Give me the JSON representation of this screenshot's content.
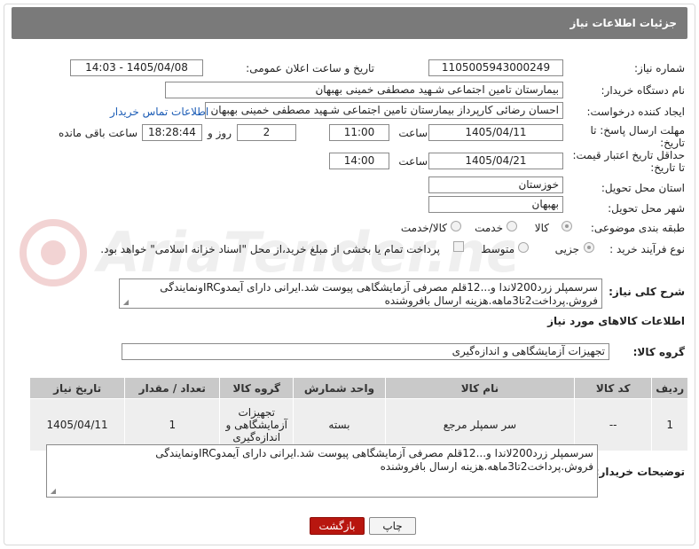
{
  "header": {
    "title": "جزئیات اطلاعات نیاز"
  },
  "fields": {
    "need_number": {
      "label": "شماره نیاز:",
      "value": "1105005943000249"
    },
    "announce": {
      "label": "تاریخ و ساعت اعلان عمومی:",
      "value": "1405/04/08 - 14:03"
    },
    "buyer_org": {
      "label": "نام دستگاه خریدار:",
      "value": "بیمارستان تامین اجتماعی شـهید مصطفی خمینی بهبهان"
    },
    "creator": {
      "label": "ایجاد کننده درخواست:",
      "value": "احسان رضائی کارپرداز بیمارستان تامین اجتماعی شـهید مصطفی خمینی بهبهان",
      "contact_link": "اطلاعات تماس خریدار"
    },
    "reply_deadline": {
      "label_line1": "مهلت ارسال پاسخ: تا",
      "label_line2": "تاریخ:",
      "date": "1405/04/11",
      "time_label": "ساعت",
      "time": "11:00",
      "days": "2",
      "days_label": "روز و",
      "remaining": "18:28:44",
      "remaining_label": "ساعت باقی مانده"
    },
    "price_validity": {
      "label_line1": "حداقل تاریخ اعتبار قیمت:",
      "label_line2": "تا تاریخ:",
      "date": "1405/04/21",
      "time_label": "ساعت",
      "time": "14:00"
    },
    "province": {
      "label": "استان محل تحویل:",
      "value": "خوزستان"
    },
    "city": {
      "label": "شهر محل تحویل:",
      "value": "بهبهان"
    },
    "category": {
      "label": "طبقه بندی موضوعی:",
      "options": [
        "کالا",
        "خدمت",
        "کالا/خدمت"
      ],
      "selected": "کالا"
    },
    "process": {
      "label": "نوع فرآیند خرید :",
      "options": [
        "جزیی",
        "متوسط"
      ],
      "selected": "جزیی",
      "payment_note": "پرداخت تمام یا بخشی از مبلغ خرید،از محل \"اسناد خزانه اسلامی\" خواهد بود."
    }
  },
  "summary": {
    "label": "شرح کلی نیاز:",
    "text": "سرسمپلر زرد200لاندا و...12قلم مصرفی آزمایشگاهی پیوست شد.ایرانی دارای آیمدوIRCونمایندگی فروش.پرداخت2تا3ماهه.هزینه ارسال بافروشنده"
  },
  "goods": {
    "section_title": "اطلاعات کالاهای مورد نیاز",
    "group_label": "گروه کالا:",
    "group_value": "تجهیزات آزمایشگاهی و اندازه‌گیری",
    "columns": [
      "ردیف",
      "کد کالا",
      "نام کالا",
      "واحد شمارش",
      "گروه کالا",
      "تعداد / مقدار",
      "تاریخ نیاز"
    ],
    "rows": [
      {
        "row": "1",
        "code": "--",
        "name": "سر سمپلر مرجع",
        "unit": "بسته",
        "group": "تجهیزات آزمایشگاهی و اندازه‌گیری",
        "qty": "1",
        "date": "1405/04/11"
      }
    ]
  },
  "buyer_notes": {
    "label": "توضیحات خریدار:",
    "text": "سرسمپلر زرد200لاندا و...12قلم مصرفی آزمایشگاهی پیوست شد.ایرانی دارای آیمدوIRCونمایندگی فروش.پرداخت2تا3ماهه.هزینه ارسال بافروشنده"
  },
  "buttons": {
    "print": "چاپ",
    "back": "بازگشت"
  },
  "watermark": {
    "text": "AriaTender.net"
  },
  "colors": {
    "header_bg": "#7a7a7a",
    "table_header_bg": "#c9c9c9",
    "back_button": "#b8160f",
    "link": "#1a5bb5"
  }
}
